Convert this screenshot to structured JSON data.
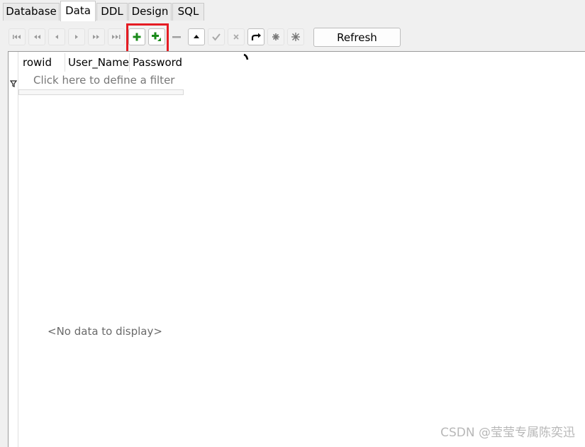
{
  "tabs": [
    {
      "label": "Database"
    },
    {
      "label": "Data"
    },
    {
      "label": "DDL"
    },
    {
      "label": "Design"
    },
    {
      "label": "SQL"
    }
  ],
  "toolbar": {
    "refresh_label": "Refresh",
    "buttons": [
      "first-record-icon",
      "previous-page-icon",
      "previous-record-icon",
      "next-record-icon",
      "next-page-icon",
      "last-record-icon",
      "insert-record-icon",
      "append-record-icon",
      "delete-record-icon",
      "edit-record-icon",
      "post-edit-icon",
      "cancel-edit-icon",
      "refresh-record-icon",
      "set-null-icon",
      "set-default-icon"
    ]
  },
  "grid": {
    "columns": [
      "rowid",
      "User_Name",
      "Password"
    ],
    "filter_placeholder": "Click here to define a filter",
    "empty_text": "<No data to display>"
  },
  "watermark": "CSDN @莹莹专属陈奕迅",
  "colors": {
    "highlight": "#e51c23",
    "add_green": "#1a8a1a"
  }
}
